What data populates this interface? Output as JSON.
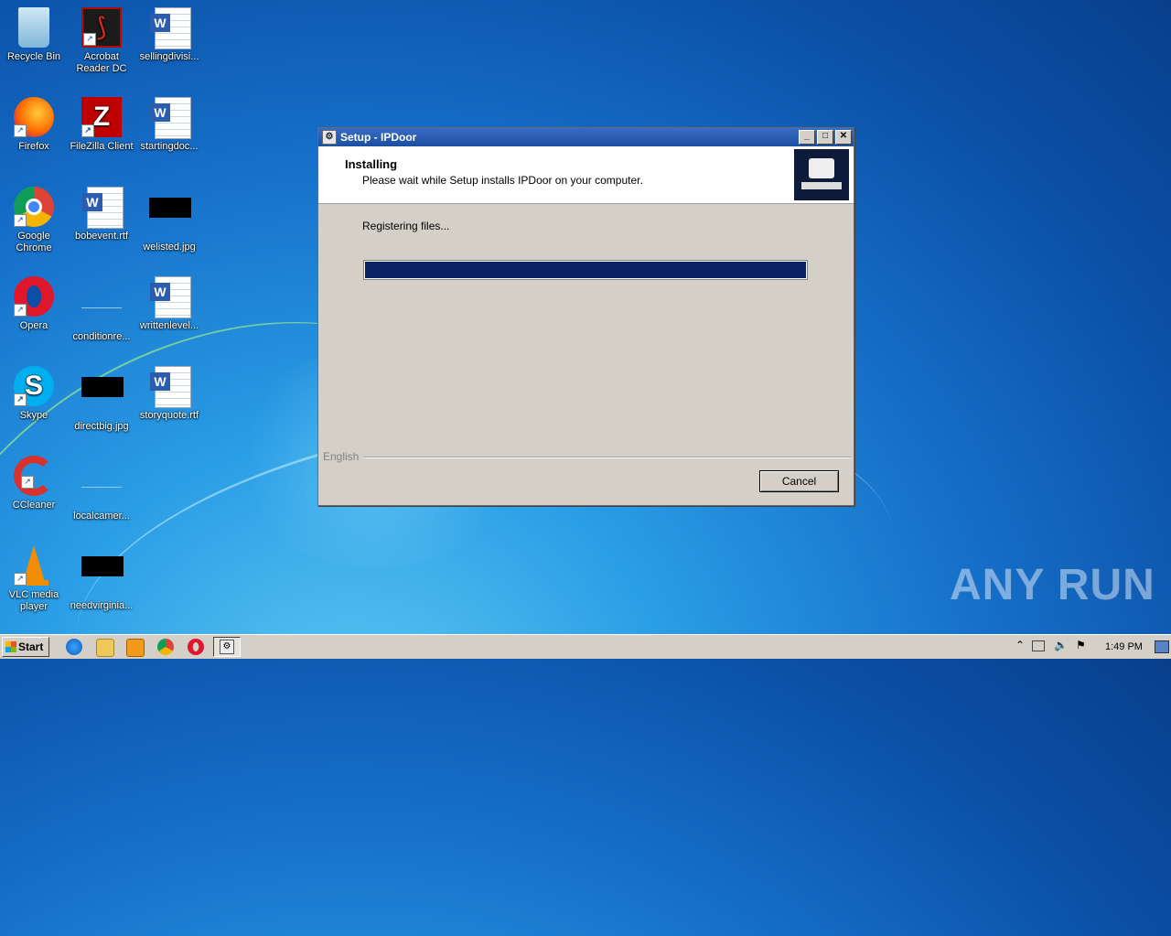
{
  "desktop": {
    "icons": [
      {
        "label": "Recycle Bin"
      },
      {
        "label": "Acrobat Reader DC"
      },
      {
        "label": "sellingdivisi..."
      },
      {
        "label": "Firefox"
      },
      {
        "label": "FileZilla Client"
      },
      {
        "label": "startingdoc..."
      },
      {
        "label": "Google Chrome"
      },
      {
        "label": "bobevent.rtf"
      },
      {
        "label": "welisted.jpg"
      },
      {
        "label": "Opera"
      },
      {
        "label": "conditionre..."
      },
      {
        "label": "writtenlevel..."
      },
      {
        "label": "Skype"
      },
      {
        "label": "directbig.jpg"
      },
      {
        "label": "storyquote.rtf"
      },
      {
        "label": "CCleaner"
      },
      {
        "label": "localcamer..."
      },
      {
        "label": "VLC media player"
      },
      {
        "label": "needvirginia..."
      }
    ]
  },
  "window": {
    "title": "Setup - IPDoor",
    "heading": "Installing",
    "subheading": "Please wait while Setup installs IPDoor on your computer.",
    "status": "Registering files...",
    "progress_fraction": 1.0,
    "language": "English",
    "cancel_label": "Cancel"
  },
  "taskbar": {
    "start_label": "Start",
    "clock": "1:49 PM"
  },
  "watermark": "ANY RUN"
}
